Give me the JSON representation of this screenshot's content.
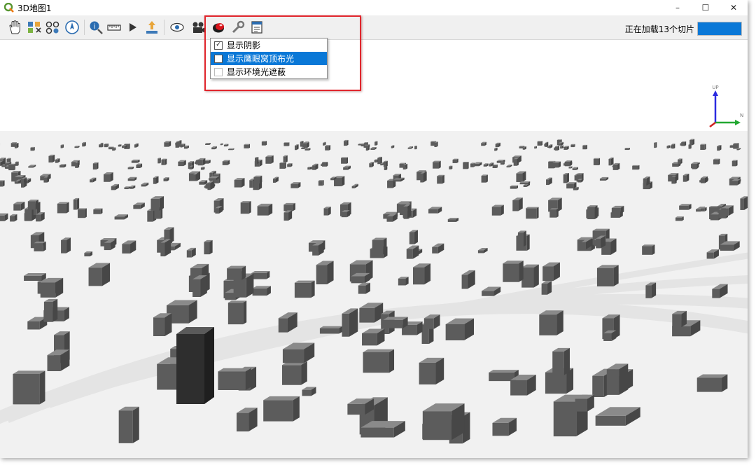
{
  "window": {
    "title": "3D地图1",
    "controls": {
      "minimize": "–",
      "maximize": "☐",
      "close": "✕"
    }
  },
  "toolbar": {
    "buttons": [
      {
        "name": "pan-icon"
      },
      {
        "name": "zoom-full-icon"
      },
      {
        "name": "camera-control-icon"
      },
      {
        "name": "north-icon"
      },
      {
        "name": "identify-icon"
      },
      {
        "name": "measure-icon"
      },
      {
        "name": "play-icon"
      },
      {
        "name": "export-icon"
      },
      {
        "name": "view-icon"
      },
      {
        "name": "camera-icon"
      },
      {
        "name": "effects-icon"
      },
      {
        "name": "settings-icon"
      },
      {
        "name": "options-icon"
      }
    ],
    "status_text": "正在加载13个切片",
    "progress": 1.0
  },
  "effects_menu": {
    "items": [
      {
        "label": "显示阴影",
        "checked": true,
        "active": false
      },
      {
        "label": "显示鹰眼窝顶布光",
        "checked": false,
        "active": true
      },
      {
        "label": "显示环境光遮蔽",
        "checked": false,
        "active": false
      }
    ]
  },
  "axis_gizmo": {
    "up_label": "UP",
    "north_label": "N"
  },
  "colors": {
    "accent": "#0a78d7",
    "highlight": "#e0252c",
    "building": "#6b6b6b"
  }
}
